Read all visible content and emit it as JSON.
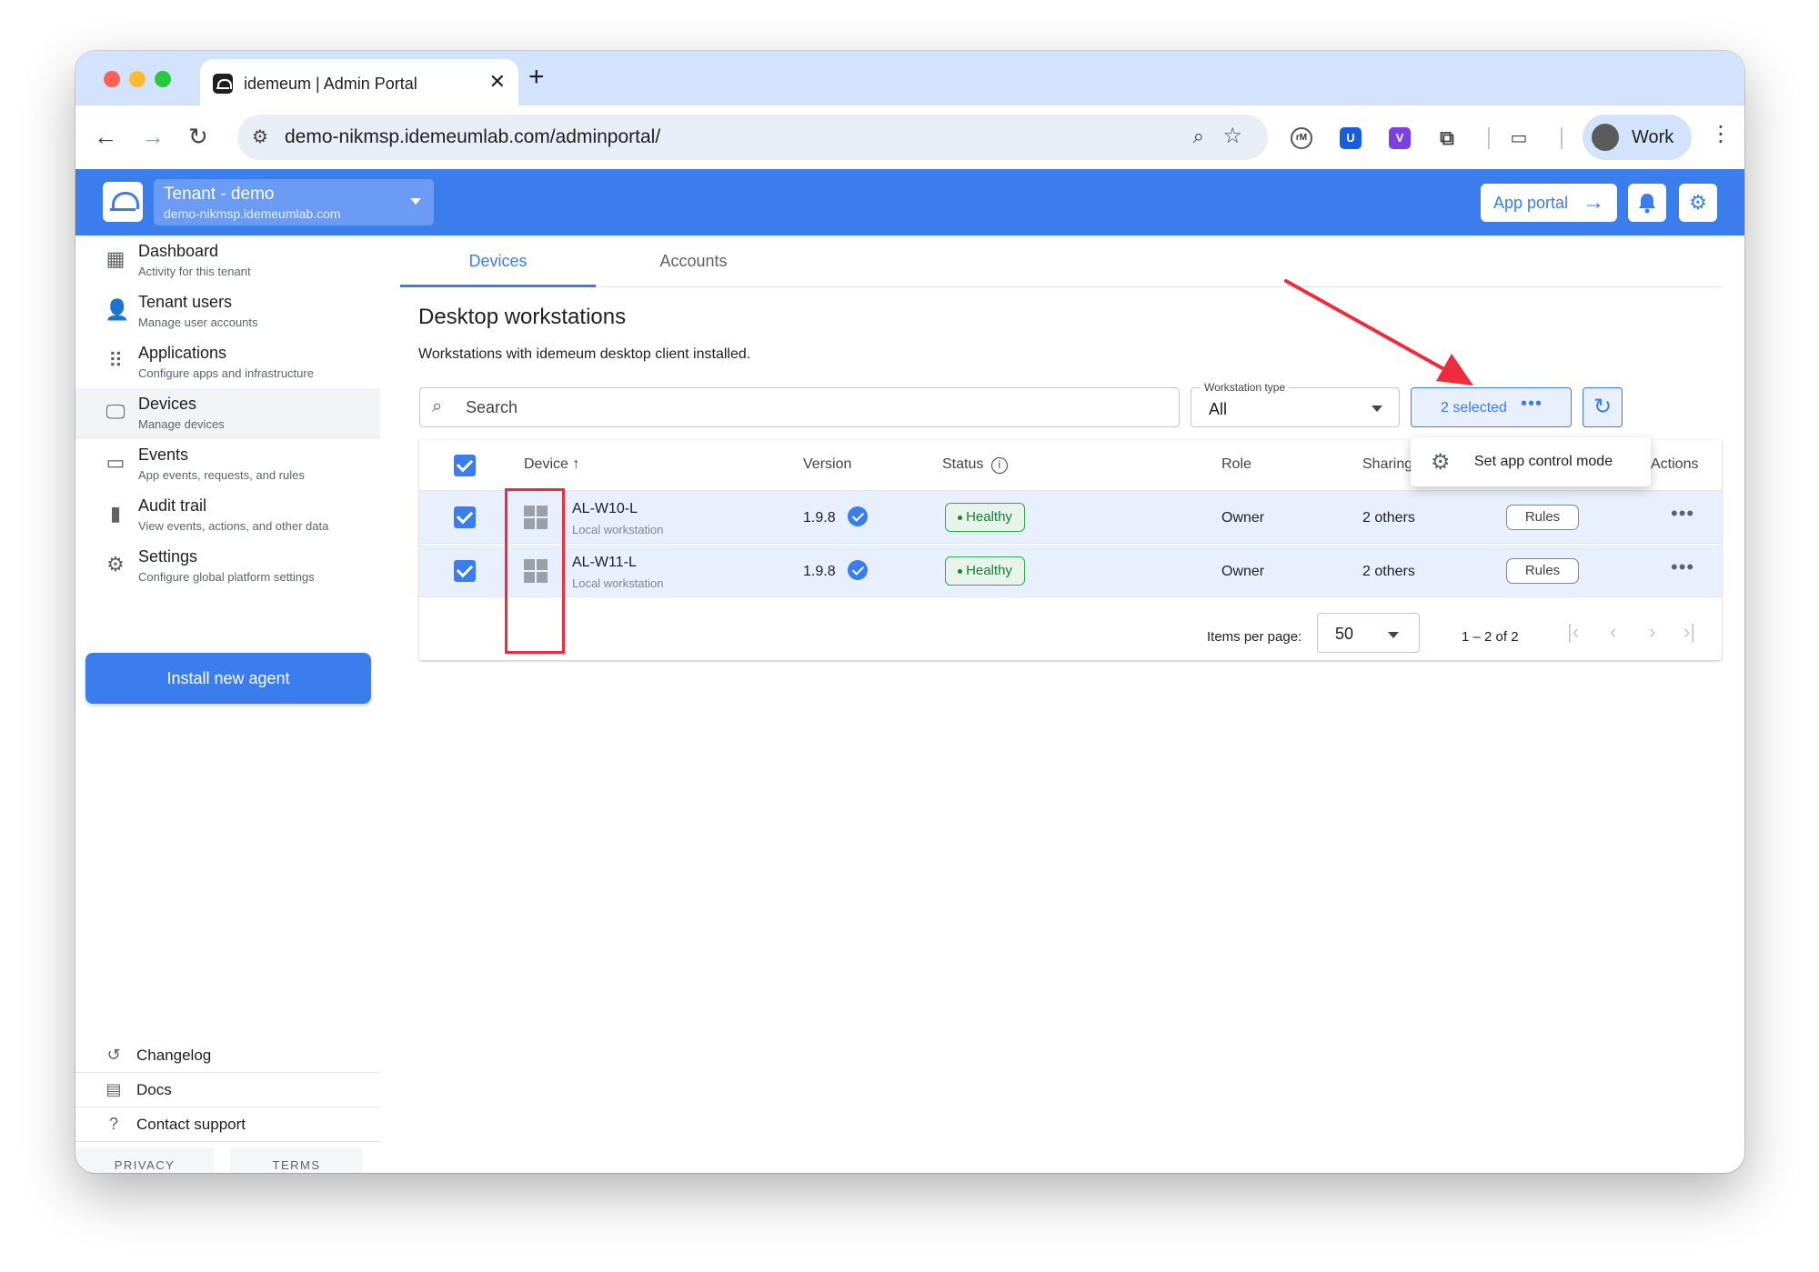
{
  "browser": {
    "tab_title": "idemeum | Admin Portal",
    "tab_close": "✕",
    "new_tab": "+",
    "url": "demo-nikmsp.idemeumlab.com/adminportal/",
    "profile_label": "Work",
    "extensions": {
      "rm": "rM",
      "bitwarden": "U",
      "v": "V"
    }
  },
  "header": {
    "tenant_name": "Tenant - demo",
    "tenant_domain": "demo-nikmsp.idemeumlab.com",
    "app_portal_label": "App portal",
    "app_portal_arrow": "→"
  },
  "sidebar": {
    "items": [
      {
        "title": "Dashboard",
        "subtitle": "Activity for this tenant",
        "icon": "dashboard-icon"
      },
      {
        "title": "Tenant users",
        "subtitle": "Manage user accounts",
        "icon": "person-icon"
      },
      {
        "title": "Applications",
        "subtitle": "Configure apps and infrastructure",
        "icon": "apps-grid-icon"
      },
      {
        "title": "Devices",
        "subtitle": "Manage devices",
        "icon": "monitor-icon",
        "active": true
      },
      {
        "title": "Events",
        "subtitle": "App events, requests, and rules",
        "icon": "devices-icon"
      },
      {
        "title": "Audit trail",
        "subtitle": "View events, actions, and other data",
        "icon": "bar-chart-icon"
      },
      {
        "title": "Settings",
        "subtitle": "Configure global platform settings",
        "icon": "gear-icon"
      }
    ],
    "install_button": "Install new agent",
    "footer": [
      {
        "label": "Changelog",
        "icon": "history-icon"
      },
      {
        "label": "Docs",
        "icon": "document-icon"
      },
      {
        "label": "Contact support",
        "icon": "help-icon"
      }
    ],
    "privacy": "PRIVACY",
    "terms": "TERMS"
  },
  "main": {
    "tabs": [
      {
        "label": "Devices",
        "active": true
      },
      {
        "label": "Accounts",
        "active": false
      }
    ],
    "title": "Desktop workstations",
    "description": "Workstations with idemeum desktop client installed.",
    "search_placeholder": "Search",
    "workstation_type": {
      "label": "Workstation type",
      "value": "All"
    },
    "selected_button": "2 selected",
    "selected_dots": "•••",
    "menu": {
      "set_app_control_mode": "Set app control mode"
    },
    "table": {
      "headers": {
        "device": "Device",
        "sort": "↑",
        "version": "Version",
        "status": "Status",
        "status_info": "i",
        "role": "Role",
        "sharing": "Sharing",
        "actions": "Actions"
      },
      "rows": [
        {
          "name": "AL-W10-L",
          "type": "Local workstation",
          "version": "1.9.8",
          "status": "Healthy",
          "role": "Owner",
          "sharing": "2 others",
          "rules": "Rules",
          "menu": "•••"
        },
        {
          "name": "AL-W11-L",
          "type": "Local workstation",
          "version": "1.9.8",
          "status": "Healthy",
          "role": "Owner",
          "sharing": "2 others",
          "rules": "Rules",
          "menu": "•••"
        }
      ]
    },
    "pagination": {
      "items_per_page_label": "Items per page:",
      "items_per_page": "50",
      "range": "1 – 2 of 2",
      "first": "|‹",
      "prev": "‹",
      "next": "›",
      "last": "›|"
    }
  },
  "colors": {
    "brand": "#3b7ded",
    "healthy": "#188038",
    "annotation": "#ef2b3d"
  }
}
